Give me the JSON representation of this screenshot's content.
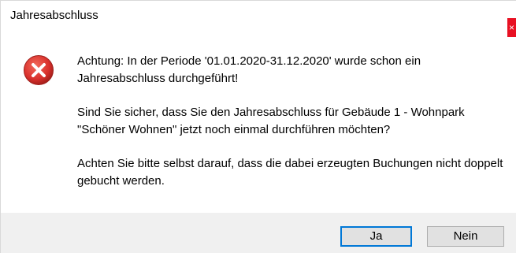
{
  "window": {
    "title": "Jahresabschluss",
    "close_label": "×"
  },
  "icon": "error-icon",
  "message": {
    "paragraph1": "Achtung: In der Periode '01.01.2020-31.12.2020' wurde schon ein Jahresabschluss durchgeführt!",
    "paragraph2": "Sind Sie sicher, dass Sie den Jahresabschluss für Gebäude 1 - Wohnpark \"Schöner Wohnen\" jetzt noch einmal durchführen möchten?",
    "paragraph3": "Achten Sie bitte selbst darauf, dass die dabei erzeugten Buchungen nicht doppelt gebucht werden."
  },
  "buttons": {
    "yes_label": "Ja",
    "no_label": "Nein"
  },
  "colors": {
    "close_bg": "#e81123",
    "icon_red": "#d9302c",
    "footer_bg": "#f0f0f0",
    "focus_border": "#0078d7"
  }
}
